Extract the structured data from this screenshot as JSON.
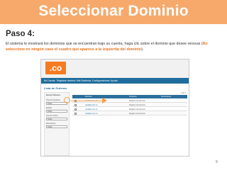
{
  "slide": {
    "title": "Seleccionar Dominio",
    "step_title": "Paso 4:",
    "desc_text": "El sistema le mostrará los dominios que se encuentran bajo su cuenta, haga clic sobre el dominio que desee renovar (",
    "desc_highlight_a": "No",
    "desc_highlight_b": "seleccione en ningún caso el cuadro que aparece a la izquierda del dominio",
    "desc_end": ").",
    "page_number": "9"
  },
  "screenshot": {
    "logo_text": ".co",
    "nav": [
      "Mi Cuenta",
      "Registrar dominio",
      "Mis Dominios",
      "Configuraciones",
      "Ayuda"
    ],
    "header": "Lista de Órdenes",
    "sidebar": {
      "title": "Buscar Órdenes",
      "field_labels": [
        "Tipo de Producto",
        "Estado",
        "Tipo de Orden",
        "Descripción"
      ],
      "field_values": [
        "Todos",
        "Todos",
        "Todos",
        "Todos"
      ]
    },
    "table": {
      "columns": [
        "Dominio",
        "Producto",
        "Vencimiento"
      ],
      "pager": "1 de 1",
      "rows": [
        {
          "domain": "cuidado.com.co",
          "product": "Registro de Dominio",
          "expiry": ""
        },
        {
          "domain": "cuidado.com.co",
          "product": "Registro de Dominio",
          "expiry": ""
        },
        {
          "domain": "cuidado.com.co",
          "product": "Registro de Dominio",
          "expiry": ""
        },
        {
          "domain": "cuidado.com.co",
          "product": "Registro de Dominio",
          "expiry": ""
        }
      ]
    }
  },
  "colors": {
    "title_bar": "#f6a96b",
    "accent_orange": "#e8731d",
    "nav_blue": "#1f6d9c"
  }
}
